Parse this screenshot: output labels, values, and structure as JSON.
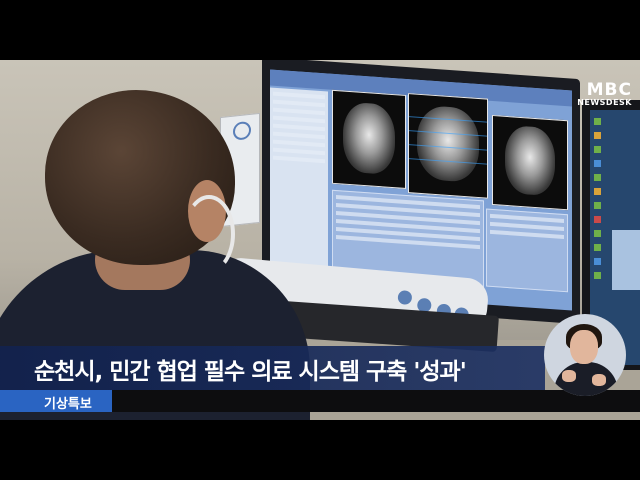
{
  "broadcast": {
    "channel_logo": "MBC",
    "channel_logo_sub": "NEWSDESK",
    "headline": "순천시, 민간 협업 필수 의료 시스템 구축 '성과'",
    "section_tag": "기상특보"
  },
  "colors": {
    "caption_bg": "#1c3062",
    "tag_bg": "#2a64c2",
    "screen_bg": "#7fa2d6"
  },
  "icons": [
    "mri-scan-image",
    "monitor",
    "keyboard",
    "sign-language-interpreter"
  ]
}
